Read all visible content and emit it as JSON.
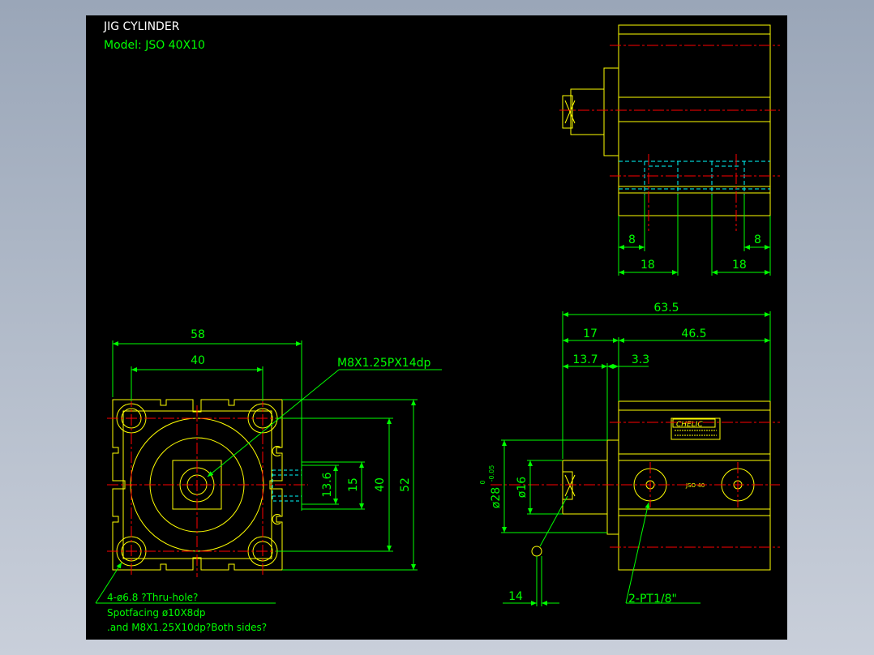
{
  "title": {
    "line1": "JIG CYLINDER",
    "line2": "Model:  JSO 40X10"
  },
  "colors": {
    "background": "#000000",
    "outline": "#ffff00",
    "dimension": "#00ff00",
    "centerline": "#ff0000",
    "hidden": "#00ffff",
    "title_white": "#ffffff"
  },
  "dimensions": {
    "front": {
      "width_outer": "58",
      "width_inner": "40",
      "h_13_6": "13.6",
      "h_15": "15",
      "h_40": "40",
      "h_52": "52",
      "thread_callout": "M8X1.25PX14dp"
    },
    "top": {
      "left_8": "8",
      "left_18": "18",
      "right_8": "8",
      "right_18": "18"
    },
    "side": {
      "total": "63.5",
      "rod": "17",
      "body": "46.5",
      "d_13_7": "13.7",
      "d_3_3": "3.3",
      "dia_16": "ø16",
      "dia_28": "ø28",
      "tol_upper": "0",
      "tol_lower": "-0.05",
      "d_14": "14",
      "port_callout": "2-PT1/8\""
    }
  },
  "notes": {
    "line1": "4-ø6.8  ?Thru-hole?",
    "line2": "Spotfacing  ø10X8dp",
    "line3": ".and M8X1.25X10dp?Both sides?"
  },
  "label_plate": {
    "brand": "CHELIC",
    "small": "JSO 40"
  }
}
